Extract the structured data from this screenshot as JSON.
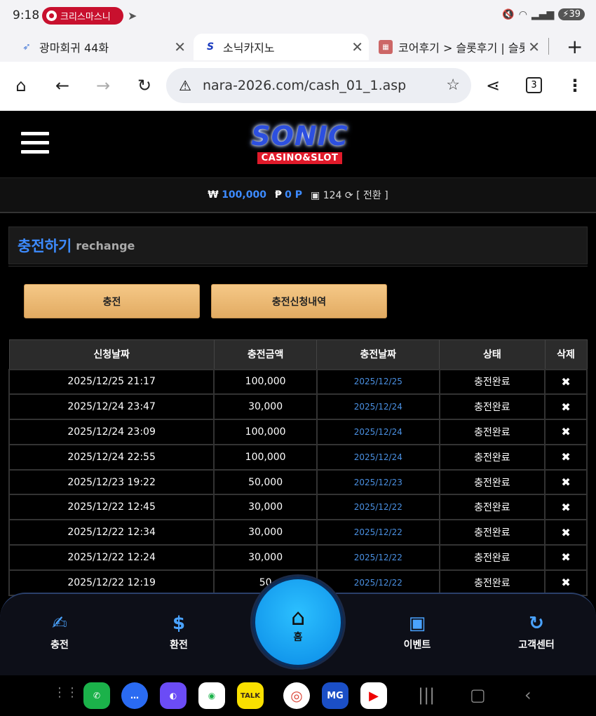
{
  "status": {
    "time": "9:18",
    "chip": "크리스마스니",
    "battery": "39"
  },
  "tabs": [
    {
      "title": "광마회귀 44화"
    },
    {
      "title": "소닉카지노"
    },
    {
      "title": "코어후기 > 슬롯후기 | 슬롯"
    }
  ],
  "browser": {
    "url": "nara-2026.com/cash_01_1.asp",
    "tab_count": "3"
  },
  "logo": {
    "main": "SONIC",
    "sub": "CASINO&SLOT"
  },
  "balance": {
    "won_symbol": "₩",
    "won": "100,000",
    "point_symbol": "₱",
    "point": "0 P",
    "coin": "124",
    "convert": "[ 전환 ]"
  },
  "section": {
    "title": "충전하기",
    "subtitle": "rechange"
  },
  "buttons": {
    "charge": "충전",
    "history": "충전신청내역"
  },
  "table": {
    "headers": [
      "신청날짜",
      "충전금액",
      "충전날짜",
      "상태",
      "삭제"
    ],
    "rows": [
      {
        "req": "2025/12/25 21:17",
        "amount": "100,000",
        "date": "2025/12/25",
        "status": "충전완료"
      },
      {
        "req": "2025/12/24 23:47",
        "amount": "30,000",
        "date": "2025/12/24",
        "status": "충전완료"
      },
      {
        "req": "2025/12/24 23:09",
        "amount": "100,000",
        "date": "2025/12/24",
        "status": "충전완료"
      },
      {
        "req": "2025/12/24 22:55",
        "amount": "100,000",
        "date": "2025/12/24",
        "status": "충전완료"
      },
      {
        "req": "2025/12/23 19:22",
        "amount": "50,000",
        "date": "2025/12/23",
        "status": "충전완료"
      },
      {
        "req": "2025/12/22 12:45",
        "amount": "30,000",
        "date": "2025/12/22",
        "status": "충전완료"
      },
      {
        "req": "2025/12/22 12:34",
        "amount": "30,000",
        "date": "2025/12/22",
        "status": "충전완료"
      },
      {
        "req": "2025/12/22 12:24",
        "amount": "30,000",
        "date": "2025/12/22",
        "status": "충전완료"
      },
      {
        "req": "2025/12/22 12:19",
        "amount": "50",
        "date": "2025/12/22",
        "status": "충전완료"
      }
    ],
    "delete_glyph": "✖"
  },
  "bottom_nav": {
    "charge": "충전",
    "exchange": "환전",
    "home": "홈",
    "event": "이벤트",
    "support": "고객센터"
  },
  "apps": {
    "talk": "TALK",
    "mg": "MG"
  },
  "colors": {
    "accent": "#3d8bff",
    "button": "#e9b56e",
    "home": "#1aa8f5"
  }
}
